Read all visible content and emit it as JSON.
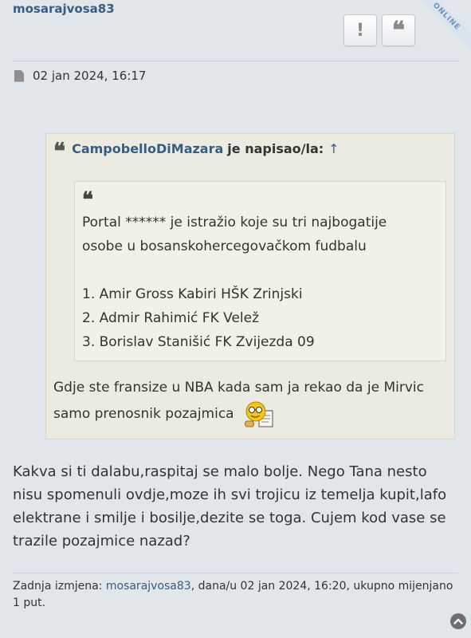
{
  "post": {
    "username": "mosarajvosa83",
    "online_label": "ONLINE",
    "report_icon": "!",
    "quote_icon": "❝",
    "date": "02 jan 2024, 16:17"
  },
  "quote": {
    "author": "CampobelloDiMazara",
    "says": "je napisao/la:",
    "arrow": "↑",
    "nested_lines": [
      "Portal ****** je istražio koje su tri najbogatije",
      "osobe u bosanskohercegovačkom fudbalu",
      "1. Amir Gross Kabiri HŠK Zrinjski",
      "2. Admir Rahimić FK Velež",
      "3. Borislav Stanišić FK Zvijezda 09"
    ],
    "text_line1": "Gdje ste fransize u NBA kada sam ja rekao da je Mirvic",
    "text_line2": "samo prenosnik pozajmica"
  },
  "message": "Kakva si ti dalabu,raspitaj se malo bolje. Nego Tana nesto nisu spomenuli ovdje,moze ih svi trojicu iz temelja kupit,lafo elektrane i smilje i bosilje,dezite se toga. Cujem kod vase se trazile pozajmice nazad?",
  "edit": {
    "prefix": "Zadnja izmjena: ",
    "user": "mosarajvosa83",
    "suffix": ", dana/u 02 jan 2024, 16:20, ukupno mijenjano 1 put."
  },
  "icons": {
    "file": "file-icon",
    "quote": "quote-icon",
    "smiley": "reading-smiley-icon",
    "scroll_top": "chevron-up-icon"
  },
  "colors": {
    "background": "#e1e6eb",
    "link": "#385d82",
    "quote_bg": "#ecebe1",
    "nested_quote_bg": "#f2f1e8"
  }
}
